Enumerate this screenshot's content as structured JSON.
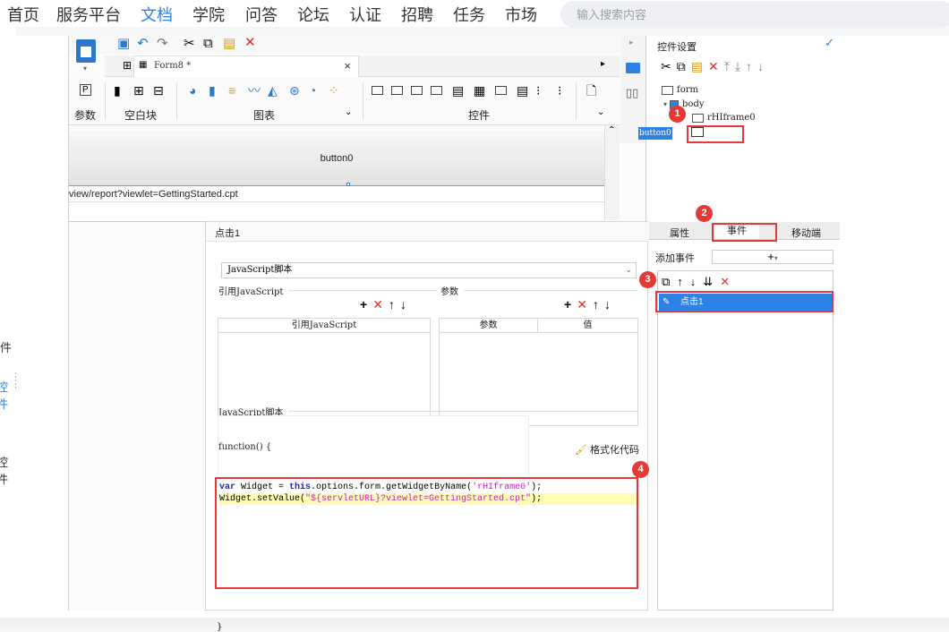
{
  "nav": {
    "items": [
      "首页",
      "服务平台",
      "文档",
      "学院",
      "问答",
      "论坛",
      "认证",
      "招聘",
      "任务",
      "市场"
    ],
    "active_index": 2,
    "search_placeholder": "输入搜索内容"
  },
  "left_strip": {
    "frag1": "件",
    "frag2": "控件",
    "frag3": "控件"
  },
  "designer": {
    "tab_label": "Form8 *",
    "ribbon_groups": {
      "params": "参数",
      "blank": "空白块",
      "chart": "图表",
      "widget": "控件"
    },
    "canvas": {
      "button_label": "button0",
      "iframe_url": "view/report?viewlet=GettingStarted.cpt"
    }
  },
  "right_panel": {
    "title": "控件设置",
    "tree": {
      "form": "form",
      "body": "body",
      "iframe": "rHIframe0",
      "button": "button0"
    },
    "tabs": [
      "属性",
      "事件",
      "移动端"
    ],
    "active_tab": "事件",
    "add_event_label": "添加事件",
    "event_item": "点击1"
  },
  "dialog": {
    "title": "点击1",
    "script_type": "JavaScript脚本",
    "ref_js_label": "引用JavaScript",
    "params_label": "参数",
    "ref_js_column": "引用JavaScript",
    "params_column_name": "参数",
    "params_column_value": "值",
    "js_script_label": "JavaScript脚本",
    "function_header": "function() {",
    "format_button": "格式化代码",
    "code": {
      "line1_var": "var",
      "line1_a": " Widget = ",
      "line1_this": "this",
      "line1_b": ".options.form.getWidgetByName(",
      "line1_str": "'rHIframe0'",
      "line1_c": ");",
      "line2_a": "Widget.setValue(",
      "line2_str": "\"${servletURL}?viewlet=GettingStarted.cpt\"",
      "line2_c": ");"
    },
    "closing_brace": "}"
  },
  "annotations": [
    "1",
    "2",
    "3",
    "4"
  ],
  "colors": {
    "accent_blue": "#2e82e6",
    "annotation_red": "#e53935",
    "delete_red": "#e12d2d",
    "highlight_yellow": "#fffcb3"
  }
}
